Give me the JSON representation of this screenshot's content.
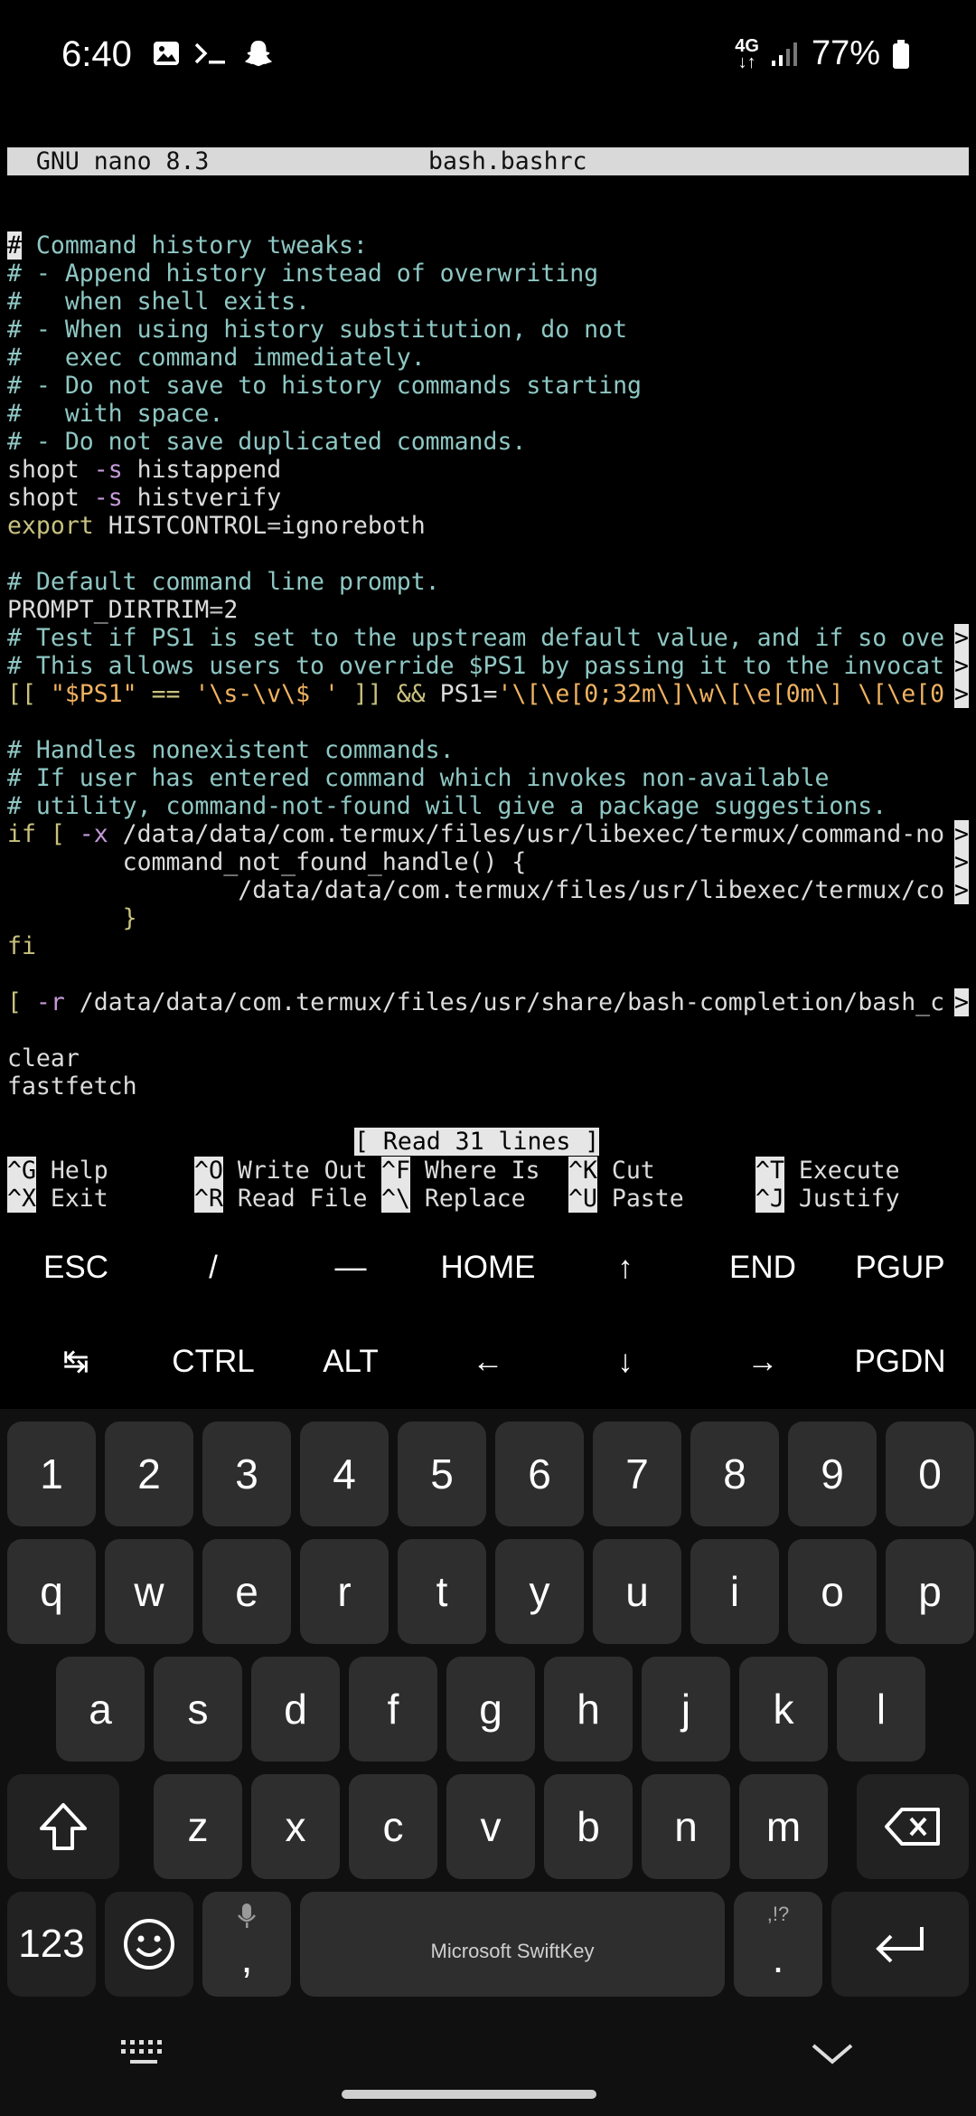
{
  "status_bar": {
    "time": "6:40",
    "network": "4G",
    "battery": "77%"
  },
  "terminal": {
    "title_left": "  GNU nano 8.3",
    "title_center": "bash.bashrc",
    "lines": [
      {
        "type": "cursor-comment",
        "cursor": "#",
        "rest": " Command history tweaks:"
      },
      {
        "type": "comment",
        "text": "# - Append history instead of overwriting"
      },
      {
        "type": "comment",
        "text": "#   when shell exits."
      },
      {
        "type": "comment",
        "text": "# - When using history substitution, do not"
      },
      {
        "type": "comment",
        "text": "#   exec command immediately."
      },
      {
        "type": "comment",
        "text": "# - Do not save to history commands starting"
      },
      {
        "type": "comment",
        "text": "#   with space."
      },
      {
        "type": "comment",
        "text": "# - Do not save duplicated commands."
      },
      {
        "type": "shopt",
        "cmd": "shopt ",
        "flag": "-s",
        "arg": " histappend"
      },
      {
        "type": "shopt",
        "cmd": "shopt ",
        "flag": "-s",
        "arg": " histverify"
      },
      {
        "type": "export",
        "kw": "export",
        "var": " HISTCONTROL",
        "eq": "=",
        "val": "ignoreboth"
      },
      {
        "type": "blank"
      },
      {
        "type": "comment",
        "text": "# Default command line prompt."
      },
      {
        "type": "assign",
        "var": "PROMPT_DIRTRIM",
        "eq": "=",
        "val": "2"
      },
      {
        "type": "comment-ovf",
        "text": "# Test if PS1 is set to the upstream default value, and if so ove"
      },
      {
        "type": "comment-ovf",
        "text": "# This allows users to override $PS1 by passing it to the invocat"
      },
      {
        "type": "ps1",
        "a": "[[ ",
        "b": "\"$PS1\"",
        "c": " == ",
        "d": "'\\s-\\v\\$ '",
        "e": " ]] && ",
        "f": "PS1=",
        "g": "'\\[\\e[0;32m\\]\\w\\[\\e[0m\\] \\[\\e[0"
      },
      {
        "type": "blank"
      },
      {
        "type": "comment",
        "text": "# Handles nonexistent commands."
      },
      {
        "type": "comment",
        "text": "# If user has entered command which invokes non-available"
      },
      {
        "type": "comment",
        "text": "# utility, command-not-found will give a package suggestions."
      },
      {
        "type": "if",
        "kw": "if",
        "a": " [ ",
        "flag": "-x",
        "rest": " /data/data/com.termux/files/usr/libexec/termux/command-no"
      },
      {
        "type": "plain-ovf",
        "text": "        command_not_found_handle() {"
      },
      {
        "type": "plain-ovf",
        "text": "                /data/data/com.termux/files/usr/libexec/termux/co"
      },
      {
        "type": "brace",
        "text": "        }"
      },
      {
        "type": "fi",
        "text": "fi"
      },
      {
        "type": "blank"
      },
      {
        "type": "test",
        "a": "[ ",
        "flag": "-r",
        "rest": " /data/data/com.termux/files/usr/share/bash-completion/bash_c"
      },
      {
        "type": "blank"
      },
      {
        "type": "plain",
        "text": "clear"
      },
      {
        "type": "plain",
        "text": "fastfetch"
      }
    ],
    "overflow_marker": ">",
    "status_message": "[ Read 31 lines ]",
    "help": [
      [
        {
          "key": "^G",
          "label": " Help"
        },
        {
          "key": "^O",
          "label": " Write Out"
        },
        {
          "key": "^F",
          "label": " Where Is"
        },
        {
          "key": "^K",
          "label": " Cut"
        },
        {
          "key": "^T",
          "label": " Execute"
        }
      ],
      [
        {
          "key": "^X",
          "label": " Exit"
        },
        {
          "key": "^R",
          "label": " Read File"
        },
        {
          "key": "^\\",
          "label": " Replace"
        },
        {
          "key": "^U",
          "label": " Paste"
        },
        {
          "key": "^J",
          "label": " Justify"
        }
      ]
    ]
  },
  "extra_keys": {
    "row1": [
      "ESC",
      "/",
      "—",
      "HOME",
      "↑",
      "END",
      "PGUP"
    ],
    "row2": [
      "↹",
      "CTRL",
      "ALT",
      "←",
      "↓",
      "→",
      "PGDN"
    ]
  },
  "keyboard": {
    "numbers": [
      "1",
      "2",
      "3",
      "4",
      "5",
      "6",
      "7",
      "8",
      "9",
      "0"
    ],
    "row1": [
      "q",
      "w",
      "e",
      "r",
      "t",
      "y",
      "u",
      "i",
      "o",
      "p"
    ],
    "row2": [
      "a",
      "s",
      "d",
      "f",
      "g",
      "h",
      "j",
      "k",
      "l"
    ],
    "row3": [
      "z",
      "x",
      "c",
      "v",
      "b",
      "n",
      "m"
    ],
    "sym_key": "123",
    "comma": ",",
    "period": ".",
    "period_sub": ",!?",
    "space_label": "Microsoft SwiftKey"
  }
}
